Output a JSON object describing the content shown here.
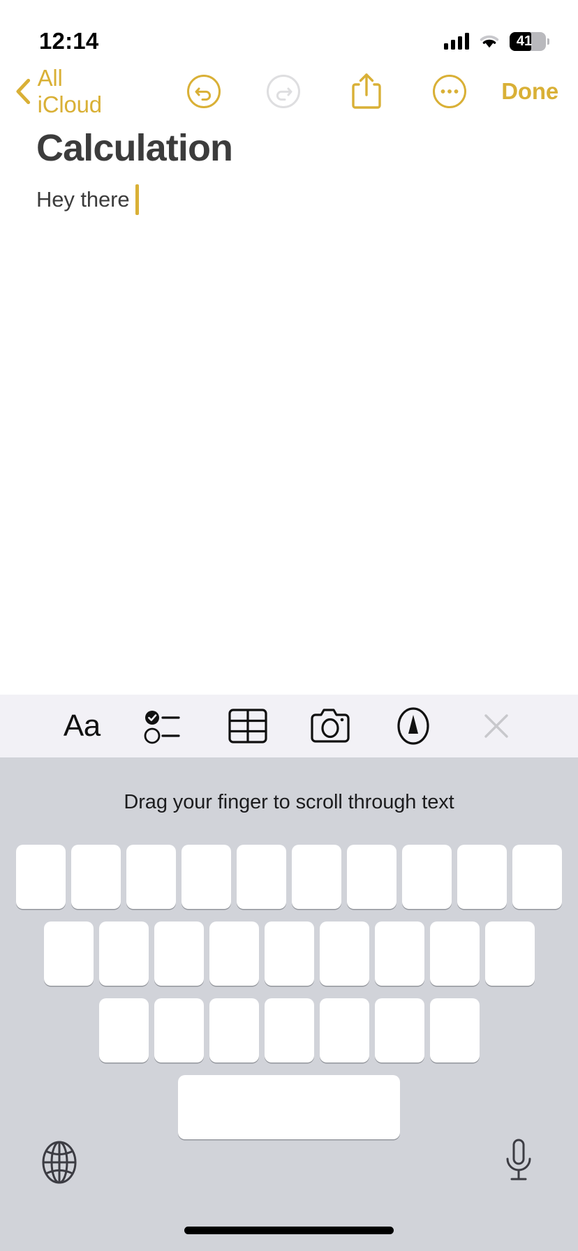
{
  "status_bar": {
    "time": "12:14",
    "signal_icon": "cellular-bars-icon",
    "wifi_icon": "wifi-icon",
    "battery_percent": "41",
    "battery_icon": "battery-icon"
  },
  "nav_bar": {
    "back_icon": "chevron-left-icon",
    "back_label": "All iCloud",
    "undo_icon": "undo-circle-icon",
    "undo_enabled": true,
    "redo_icon": "redo-circle-icon",
    "redo_enabled": false,
    "share_icon": "share-icon",
    "more_icon": "ellipsis-circle-icon",
    "done_label": "Done"
  },
  "note": {
    "title": "Calculation",
    "body": "Hey there",
    "caret_visible": true
  },
  "format_toolbar": {
    "items": [
      {
        "name": "format-button",
        "icon": "aa-text-format-icon",
        "label": "Aa",
        "enabled": true
      },
      {
        "name": "checklist-button",
        "icon": "checklist-icon",
        "label": "",
        "enabled": true
      },
      {
        "name": "table-button",
        "icon": "table-icon",
        "label": "",
        "enabled": true
      },
      {
        "name": "camera-button",
        "icon": "camera-icon",
        "label": "",
        "enabled": true
      },
      {
        "name": "markup-button",
        "icon": "markup-pen-icon",
        "label": "",
        "enabled": true
      },
      {
        "name": "close-button",
        "icon": "close-x-icon",
        "label": "",
        "enabled": false
      }
    ]
  },
  "keyboard": {
    "hint": "Drag your finger to scroll through text",
    "mode": "trackpad-scrub",
    "row_1_key_count": 10,
    "row_2_key_count": 9,
    "row_3_key_count": 7,
    "spacebar_blank": true,
    "globe_icon": "globe-icon",
    "mic_icon": "microphone-icon"
  },
  "colors": {
    "accent": "#D9B036",
    "disabled": "#D2D2D4",
    "note_text": "#3C3C3C",
    "toolbar_bg": "#F2F1F6",
    "keyboard_bg": "#D1D3D9",
    "key_bg": "#FFFFFF"
  }
}
